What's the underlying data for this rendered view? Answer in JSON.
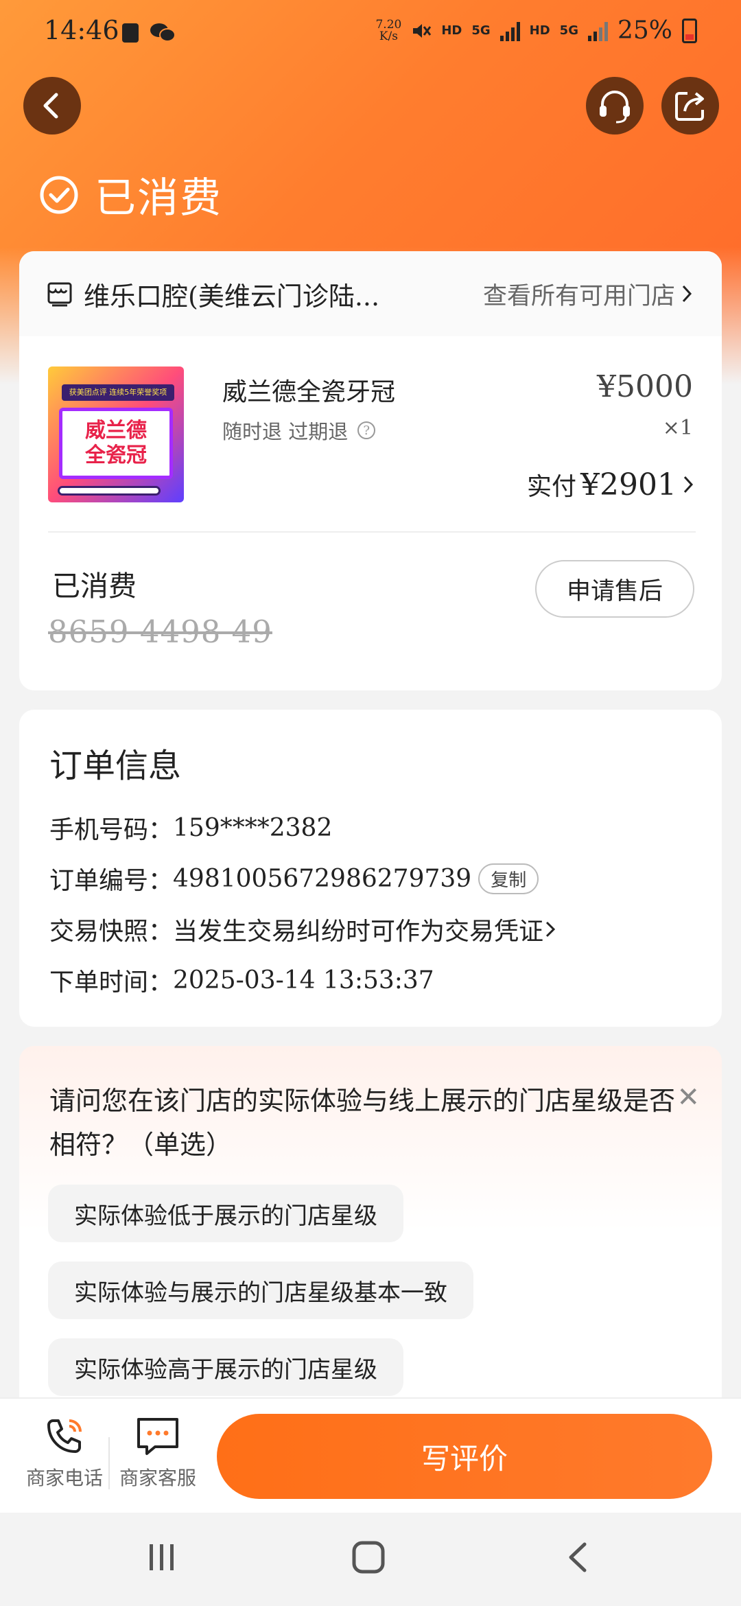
{
  "status_bar": {
    "time": "14:46",
    "net_speed_value": "7.20",
    "net_speed_unit": "K/s",
    "hd1": "HD",
    "fiveg1": "5G",
    "hd2": "HD",
    "fiveg2": "5G",
    "battery": "25%"
  },
  "header": {
    "status_title": "已消费"
  },
  "store": {
    "name": "维乐口腔(美维云门诊陆...",
    "all_stores_link": "查看所有可用门店"
  },
  "product": {
    "thumb_banner": "获美团点评 连续5年荣誉奖项",
    "thumb_line1": "威兰德",
    "thumb_line2": "全瓷冠",
    "name": "威兰德全瓷牙冠",
    "tags": "随时退  过期退",
    "price": "¥5000",
    "quantity": "×1",
    "paid_label": "实付",
    "paid_value": "¥2901"
  },
  "voucher": {
    "status": "已消费",
    "code": "8659 4498 49",
    "after_sale_button": "申请售后"
  },
  "order_info": {
    "title": "订单信息",
    "phone_label": "手机号码：",
    "phone": "159****2382",
    "order_no_label": "订单编号：",
    "order_no": "4981005672986279739",
    "copy_button": "复制",
    "snapshot_label": "交易快照：",
    "snapshot_text": "当发生交易纠纷时可作为交易凭证",
    "time_label": "下单时间：",
    "time": "2025-03-14 13:53:37"
  },
  "survey": {
    "question": "请问您在该门店的实际体验与线上展示的门店星级是否相符？（单选）",
    "options": [
      "实际体验低于展示的门店星级",
      "实际体验与展示的门店星级基本一致",
      "实际体验高于展示的门店星级"
    ]
  },
  "action_bar": {
    "merchant_phone": "商家电话",
    "merchant_service": "商家客服",
    "write_review": "写评价"
  },
  "colors": {
    "brand_orange": "#ff6f17",
    "header_dark": "#6b3312"
  }
}
